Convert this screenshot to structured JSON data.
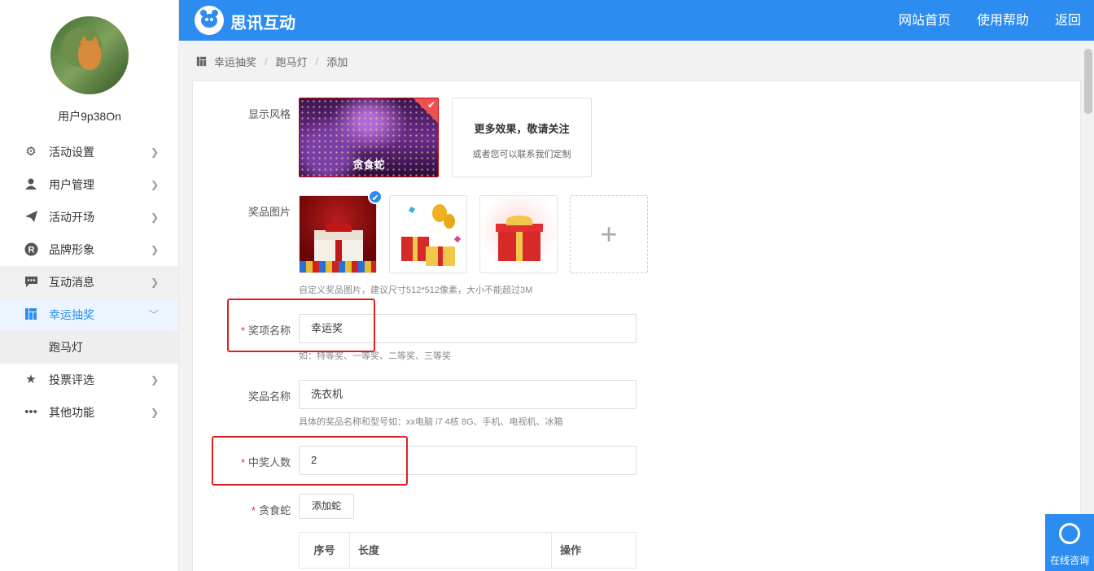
{
  "sidebar": {
    "username": "用户9p38On",
    "items": [
      {
        "label": "活动设置",
        "icon": "gears-icon"
      },
      {
        "label": "用户管理",
        "icon": "user-icon"
      },
      {
        "label": "活动开场",
        "icon": "paper-plane-icon"
      },
      {
        "label": "品牌形象",
        "icon": "registered-icon"
      },
      {
        "label": "互动消息",
        "icon": "chat-icon"
      },
      {
        "label": "幸运抽奖",
        "icon": "lottery-icon"
      },
      {
        "label": "投票评选",
        "icon": "star-icon"
      },
      {
        "label": "其他功能",
        "icon": "more-icon"
      }
    ],
    "submenu_item": "跑马灯"
  },
  "header": {
    "brand": "思讯互动",
    "nav": [
      "网站首页",
      "使用帮助",
      "返回"
    ]
  },
  "breadcrumb": [
    "幸运抽奖",
    "跑马灯",
    "添加"
  ],
  "form": {
    "style_label": "显示风格",
    "style_thumb_label": "贪食蛇",
    "more_title": "更多效果，敬请关注",
    "more_sub": "或者您可以联系我们定制",
    "prize_image_label": "奖品图片",
    "prize_image_hint": "自定义奖品图片，建议尺寸512*512像素，大小不能超过3M",
    "award_name_label": "奖项名称",
    "award_name_value": "幸运奖",
    "award_name_hint": "如：特等奖、一等奖、二等奖、三等奖",
    "prize_name_label": "奖品名称",
    "prize_name_value": "洗衣机",
    "prize_name_hint": "具体的奖品名称和型号如：xx电脑 i7 4核 8G、手机、电视机、冰箱",
    "winners_label": "中奖人数",
    "winners_value": "2",
    "snake_label": "贪食蛇",
    "add_snake_button": "添加蛇",
    "table_headers": [
      "序号",
      "长度",
      "操作"
    ]
  },
  "consult": {
    "label": "在线咨询"
  },
  "colors": {
    "primary": "#2d8cf0",
    "required": "#f5222d",
    "highlight_box": "#e02020"
  }
}
